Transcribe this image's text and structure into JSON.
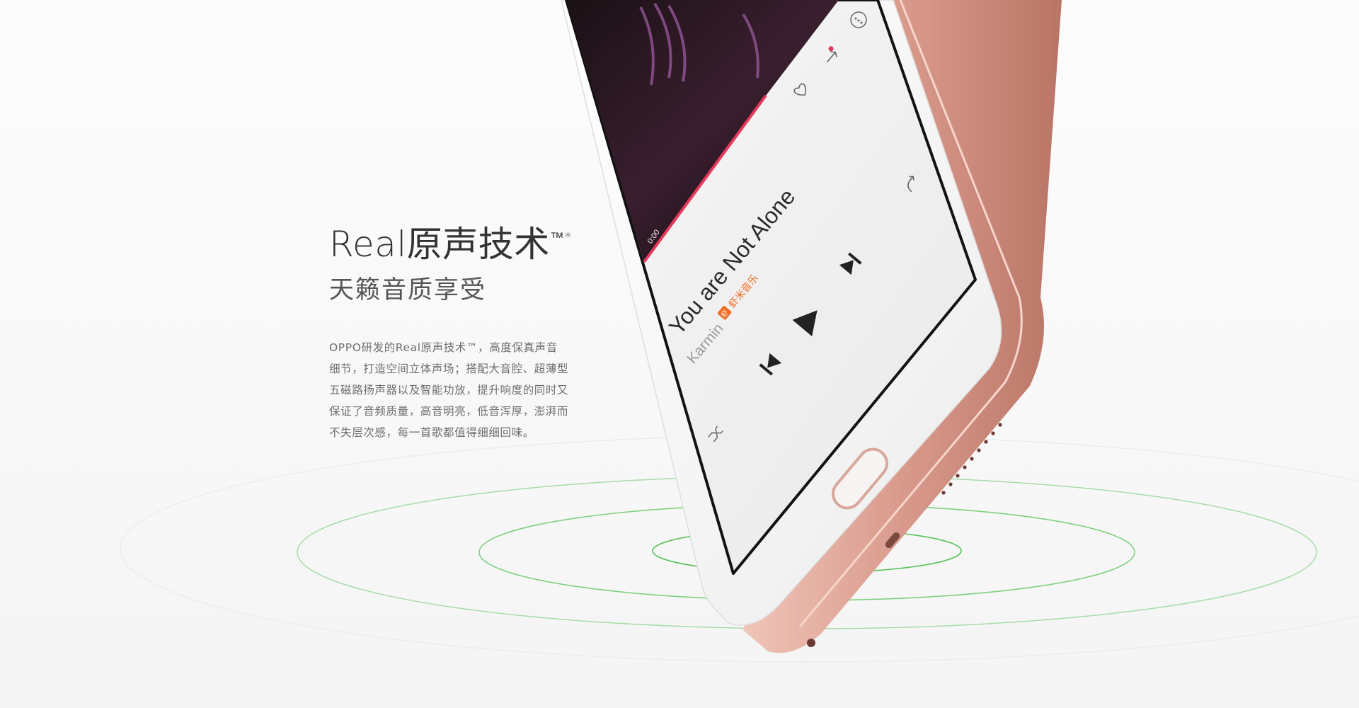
{
  "feature": {
    "headline": "Real原声技术",
    "headline_mark": "™*",
    "subhead": "天籁音质享受",
    "paragraph_lines": [
      "OPPO研发的Real原声技术™，高度保真声音",
      "细节，打造空间立体声场；搭配大音腔、超薄型",
      "五磁路扬声器以及智能功放，提升响度的同时又",
      "保证了音频质量，高音明亮，低音浑厚，澎湃而",
      "不失层次感，每一首歌都值得细细回味。"
    ]
  },
  "player": {
    "time": "0:00",
    "song_title": "You are Not Alone",
    "artist": "Karmin",
    "source_badge": "虾",
    "source_name": "虾米音乐"
  },
  "icons": {
    "more": "more-icon",
    "share": "share-icon",
    "like": "heart-icon",
    "repeat": "repeat-icon",
    "next": "next-icon",
    "play": "play-icon",
    "previous": "previous-icon",
    "shuffle": "shuffle-icon"
  },
  "colors": {
    "accent": "#e63a5c",
    "ring": "#7fd07f",
    "phone_body": "#d99a8c",
    "source_brand": "#f26a21"
  }
}
